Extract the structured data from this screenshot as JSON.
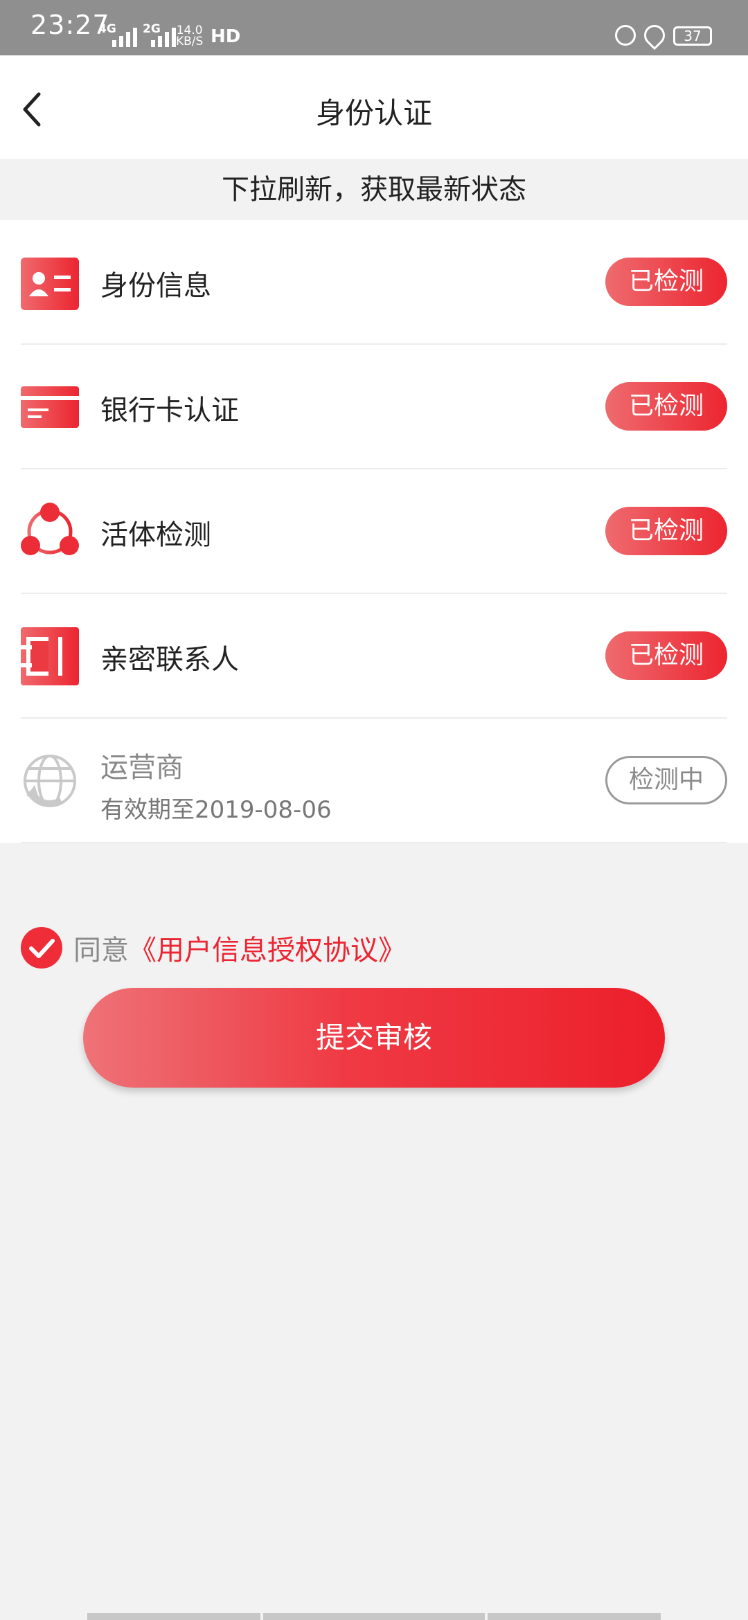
{
  "status_bar": {
    "time": "23:27",
    "network_1": "4G",
    "network_2": "2G",
    "speed_value": "14.0",
    "speed_unit": "KB/S",
    "hd": "HD",
    "battery": "37"
  },
  "header": {
    "title": "身份认证",
    "back_icon": "chevron-left-icon"
  },
  "refresh_hint": "下拉刷新，获取最新状态",
  "verification_items": [
    {
      "label": "身份信息",
      "status": "已检测",
      "icon": "id-card-icon"
    },
    {
      "label": "银行卡认证",
      "status": "已检测",
      "icon": "bank-card-icon"
    },
    {
      "label": "活体检测",
      "status": "已检测",
      "icon": "liveness-icon"
    },
    {
      "label": "亲密联系人",
      "status": "已检测",
      "icon": "contacts-icon"
    },
    {
      "label": "运营商",
      "sub": "有效期至2019-08-06",
      "status": "检测中",
      "icon": "carrier-globe-icon"
    }
  ],
  "agreement": {
    "prefix": "同意",
    "link": "《用户信息授权协议》",
    "checked": true
  },
  "submit_label": "提交审核",
  "colors": {
    "accent": "#ec2530",
    "accent_light": "#ee6b6f",
    "background": "#f2f2f2",
    "pending_gray": "#9a9a9a"
  }
}
